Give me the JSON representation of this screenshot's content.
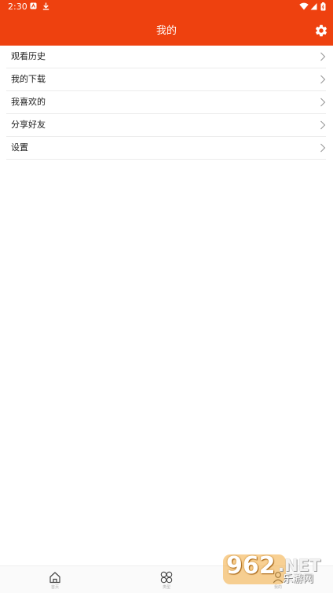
{
  "status_bar": {
    "time": "2:30"
  },
  "header": {
    "title": "我的",
    "background": "#ee410f"
  },
  "menu": {
    "items": [
      {
        "label": "观看历史"
      },
      {
        "label": "我的下载"
      },
      {
        "label": "我喜欢的"
      },
      {
        "label": "分享好友"
      },
      {
        "label": "设置"
      }
    ]
  },
  "tabbar": {
    "tabs": [
      {
        "label": "首页",
        "icon": "home-icon"
      },
      {
        "label": "类型",
        "icon": "category-icon"
      },
      {
        "label": "我的",
        "icon": "profile-icon"
      }
    ]
  },
  "watermark": {
    "number": "962",
    "suffix": ".NET",
    "text": "乐游网"
  },
  "icons": {
    "settings": "gear-icon",
    "chevron": "chevron-right-icon",
    "wifi": "wifi-icon",
    "signal": "signal-icon",
    "battery": "battery-icon"
  }
}
